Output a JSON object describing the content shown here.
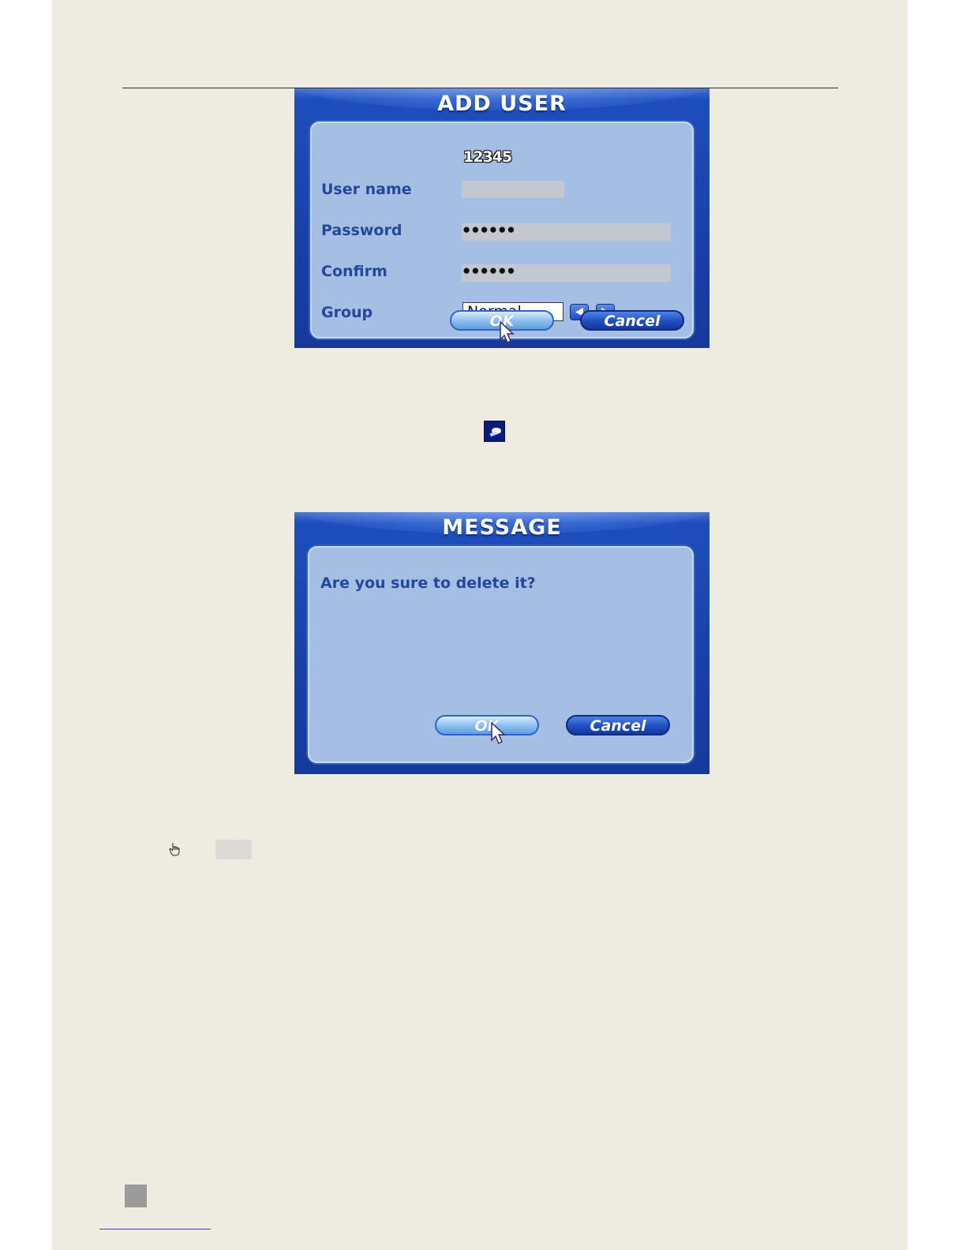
{
  "add_user_dialog": {
    "title": "ADD USER",
    "fields": {
      "username_label": "User name",
      "username_value": "12345",
      "password_label": "Password",
      "password_value": "●●●●●●",
      "confirm_label": "Confirm",
      "confirm_value": "●●●●●●",
      "group_label": "Group",
      "group_value": "Normal"
    },
    "ok_label": "OK",
    "cancel_label": "Cancel"
  },
  "message_dialog": {
    "title": "MESSAGE",
    "text": "Are you sure to delete it?",
    "ok_label": "OK",
    "cancel_label": "Cancel"
  },
  "colors": {
    "page_background": "#eeebe1",
    "dialog_frame": "#1e4fbf",
    "dialog_panel": "#a4bfe3",
    "label_text": "#26469b"
  },
  "icons": [
    "delete-user-icon",
    "left-arrow-icon",
    "right-arrow-icon",
    "pointer-cursor-icon",
    "hand-pointer-icon"
  ]
}
